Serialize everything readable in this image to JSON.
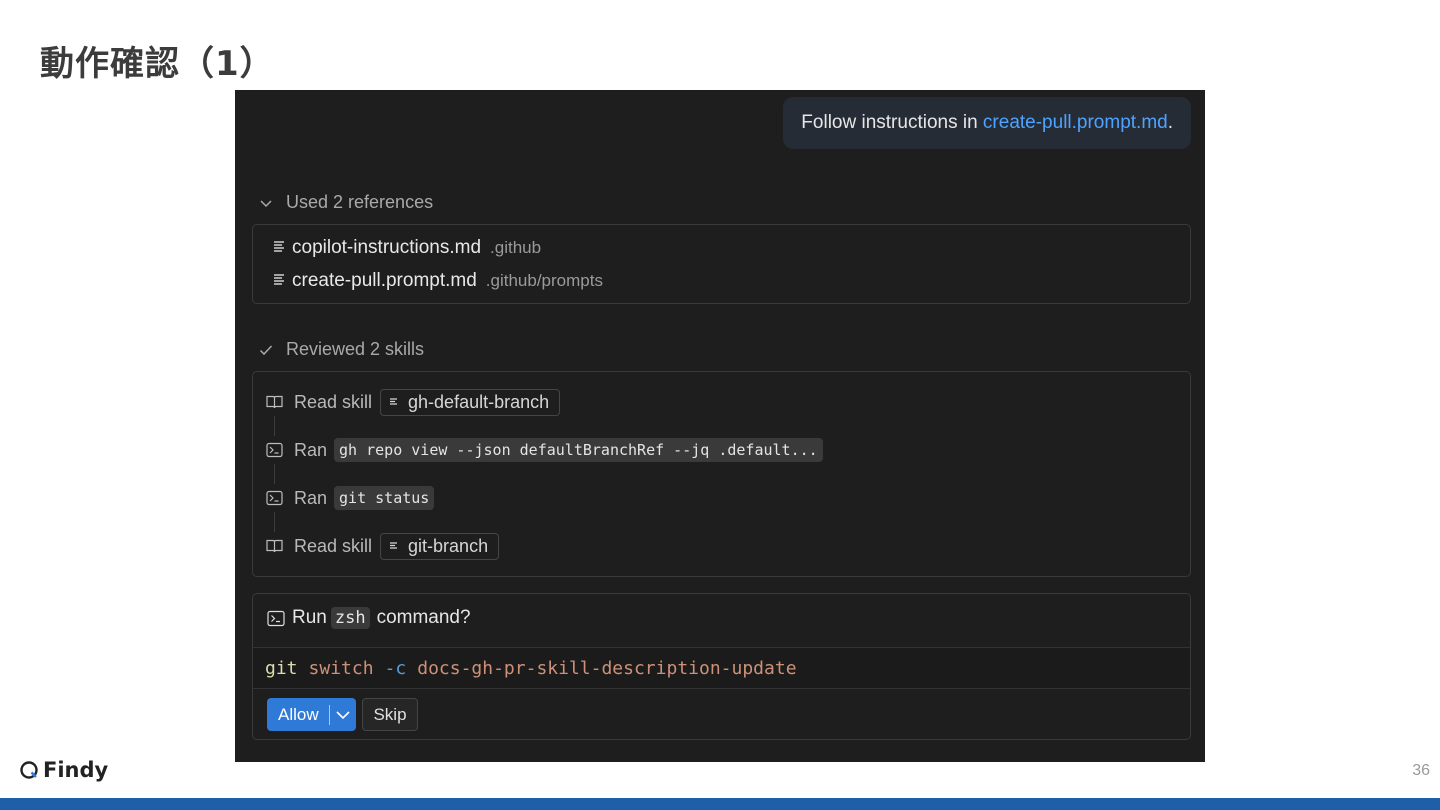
{
  "slide": {
    "title": "動作確認（1）",
    "brand": "Findy",
    "page_number": "36"
  },
  "chat": {
    "user_message": {
      "prefix": "Follow instructions in ",
      "link": "create-pull.prompt.md",
      "suffix": "."
    },
    "references": {
      "header": "Used 2 references",
      "items": [
        {
          "name": "copilot-instructions.md",
          "path": ".github"
        },
        {
          "name": "create-pull.prompt.md",
          "path": ".github/prompts"
        }
      ]
    },
    "skills": {
      "header": "Reviewed 2 skills",
      "items": [
        {
          "verb": "Read skill",
          "value": "gh-default-branch",
          "kind": "skill"
        },
        {
          "verb": "Ran",
          "value": "gh repo view --json defaultBranchRef --jq .default...",
          "kind": "command"
        },
        {
          "verb": "Ran",
          "value": "git status",
          "kind": "command"
        },
        {
          "verb": "Read skill",
          "value": "git-branch",
          "kind": "skill"
        }
      ]
    },
    "run_prompt": {
      "prefix": "Run",
      "shell": "zsh",
      "suffix": "command?",
      "command": {
        "program": "git",
        "subcommand": "switch",
        "flag": "-c",
        "argument": "docs-gh-pr-skill-description-update"
      },
      "allow_label": "Allow",
      "skip_label": "Skip"
    }
  },
  "colors": {
    "panel_bg": "#1e1e1e",
    "link": "#4da3ff",
    "allow_button": "#2f7ad6",
    "bottom_bar": "#1f5fa8"
  }
}
